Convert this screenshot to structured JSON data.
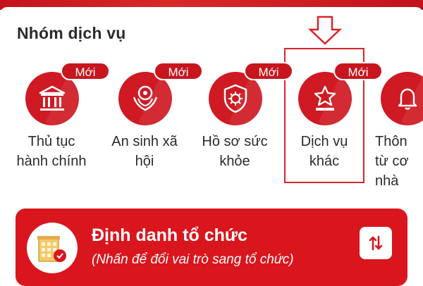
{
  "section": {
    "title": "Nhóm dịch vụ"
  },
  "services": [
    {
      "badge": "Mới",
      "line1": "Thủ tục",
      "line2": "hành chính",
      "line3": "",
      "icon": "government-building-icon"
    },
    {
      "badge": "Mới",
      "line1": "An sinh xã",
      "line2": "hội",
      "line3": "",
      "icon": "social-welfare-icon"
    },
    {
      "badge": "Mới",
      "line1": "Hồ sơ sức",
      "line2": "khỏe",
      "line3": "",
      "icon": "health-virus-shield-icon"
    },
    {
      "badge": "Mới",
      "line1": "Dịch vụ",
      "line2": "khác",
      "line3": "",
      "icon": "star-podium-icon"
    },
    {
      "badge": "",
      "line1": "Thôn",
      "line2": "từ cơ",
      "line3": "nhà",
      "icon": "bell-icon"
    }
  ],
  "banner": {
    "title": "Định danh tổ chức",
    "subtitle": "(Nhấn để đổi vai trò sang tổ chức)",
    "icon": "organization-building-icon",
    "switch_icon": "swap-arrows-icon"
  },
  "colors": {
    "primary": "#d9161d",
    "badge": "#c8161e",
    "text": "#2b2b2b"
  }
}
